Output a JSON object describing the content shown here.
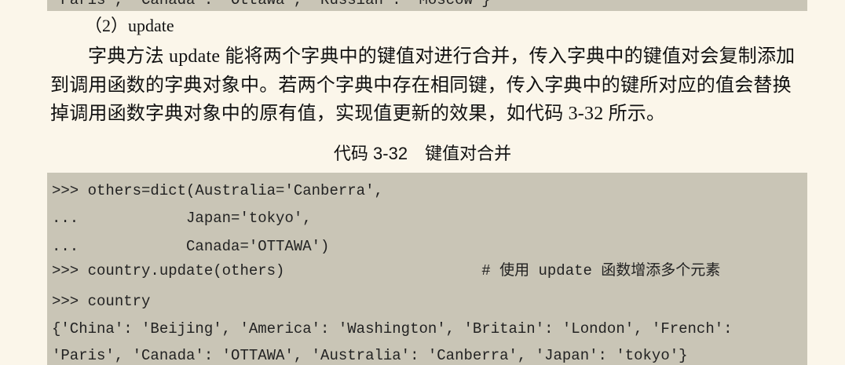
{
  "top_code": {
    "line": "'Paris', 'Canada': 'Ottawa', 'Russian': 'Moscow'}"
  },
  "section": {
    "heading": "（2）update",
    "paragraph_lines": [
      "字典方法 update 能将两个字典中的键值对进行合并，传入字典中的键值对会复制添加",
      "到调用函数的字典对象中。若两个字典中存在相同键，传入字典中的键所对应的值会替换",
      "掉调用函数字典对象中的原有值，实现值更新的效果，如代码 3-32 所示。"
    ]
  },
  "code_caption": "代码 3-32　键值对合并",
  "code_lines": [
    ">>> others=dict(Australia='Canberra',",
    "...            Japan='tokyo',",
    "...            Canada='OTTAWA')",
    ">>> country.update(others)                      # 使用 update 函数增添多个元素",
    ">>> country",
    "{'China': 'Beijing', 'America': 'Washington', 'Britain': 'London', 'French':",
    "'Paris', 'Canada': 'OTTAWA', 'Australia': 'Canberra', 'Japan': 'tokyo'}"
  ]
}
